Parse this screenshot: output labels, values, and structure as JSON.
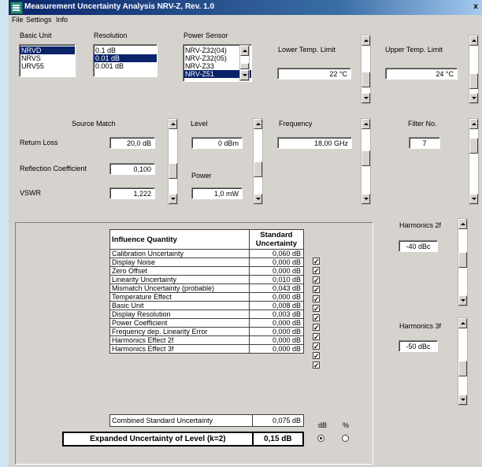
{
  "window": {
    "title": "Measurement Uncertainty Analysis NRV-Z, Rev. 1.0",
    "close_label": "x"
  },
  "menu": [
    "File",
    "Settings",
    "Info"
  ],
  "basic_unit": {
    "label": "Basic Unit",
    "options": [
      "NRVD",
      "NRVS",
      "URV55"
    ],
    "selected": "NRVD"
  },
  "resolution": {
    "label": "Resolution",
    "options": [
      "0.1 dB",
      "0.01 dB",
      "0.001 dB"
    ],
    "selected": "0.01 dB"
  },
  "power_sensor": {
    "label": "Power Sensor",
    "options": [
      "NRV-Z32(04)",
      "NRV-Z32(05)",
      "NRV-Z33",
      "NRV-Z51"
    ],
    "selected": "NRV-Z51"
  },
  "lower_temp": {
    "label": "Lower Temp. Limit",
    "value": "22 °C"
  },
  "upper_temp": {
    "label": "Upper Temp. Limit",
    "value": "24 °C"
  },
  "source_match": {
    "label": "Source Match",
    "return_loss_label": "Return Loss",
    "return_loss": "20,0 dB",
    "refl_coeff_label": "Reflection Coefficient",
    "refl_coeff": "0,100",
    "vswr_label": "VSWR",
    "vswr": "1,222"
  },
  "level": {
    "label": "Level",
    "value": "0 dBm",
    "power_label": "Power",
    "power_value": "1,0 mW"
  },
  "frequency": {
    "label": "Frequency",
    "value": "18,00 GHz"
  },
  "filter_no": {
    "label": "Filter No.",
    "value": "7"
  },
  "harmonics_2f": {
    "label": "Harmonics 2f",
    "value": "-40 dBc"
  },
  "harmonics_3f": {
    "label": "Harmonics 3f",
    "value": "-50 dBc"
  },
  "table": {
    "header_quantity": "Influence Quantity",
    "header_uncertainty": "Standard Uncertainty",
    "rows": [
      {
        "name": "Calibration Uncertainty",
        "value": "0,060 dB"
      },
      {
        "name": "Display Noise",
        "value": "0,000 dB"
      },
      {
        "name": "Zero Offset",
        "value": "0,000 dB"
      },
      {
        "name": "Linearity Uncertainty",
        "value": "0,010 dB"
      },
      {
        "name": "Mismatch Uncertainty (probable)",
        "value": "0,043 dB"
      },
      {
        "name": "Temperature Effect",
        "value": "0,000 dB"
      },
      {
        "name": "Basic Unit",
        "value": "0,008 dB"
      },
      {
        "name": "Display Resolution",
        "value": "0,003 dB"
      },
      {
        "name": "Power Coefficient",
        "value": "0,000 dB"
      },
      {
        "name": "Frequency dep. Linearity Error",
        "value": "0,000 dB"
      },
      {
        "name": "Harmonics Effect 2f",
        "value": "0,000 dB"
      },
      {
        "name": "Harmonics Effect 3f",
        "value": "0,000 dB"
      }
    ],
    "check_mark": "✓",
    "combined_label": "Combined Standard Uncertainty",
    "combined_value": "0,075 dB",
    "expanded_label": "Expanded Uncertainty of Level (k=2)",
    "expanded_value": "0,15 dB",
    "unit_db_label": "dB",
    "unit_pct_label": "%",
    "unit_selected": "dB"
  }
}
